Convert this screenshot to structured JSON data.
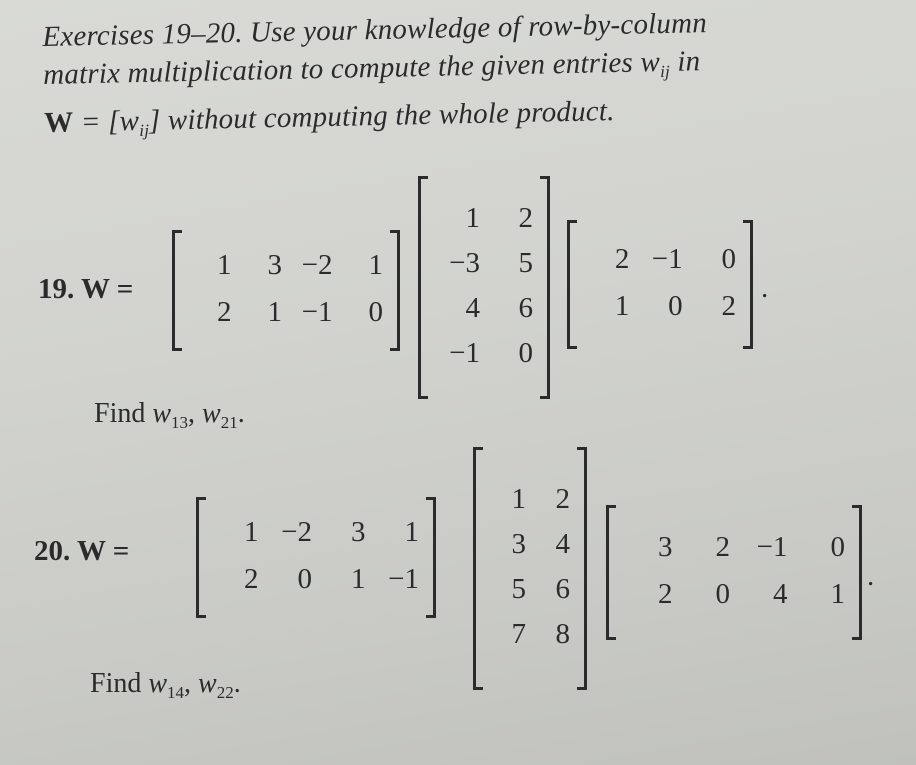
{
  "intro": {
    "line1": "Exercises 19–20.  Use  your  knowledge  of  row-by-column",
    "line2": "matrix  multiplication  to  compute  the  given  entries  w",
    "line2_sub": "ij",
    "line2_end": "  in",
    "line3_prefix": "W",
    "line3_eq": " = [w",
    "line3_sub": "ij",
    "line3_rest": "] without computing the whole product."
  },
  "exercises": [
    {
      "label": "19.  W =",
      "matrices": [
        [
          [
            "1",
            "3",
            "−2",
            "1"
          ],
          [
            "2",
            "1",
            "−1",
            "0"
          ]
        ],
        [
          [
            "1",
            "2"
          ],
          [
            "−3",
            "5"
          ],
          [
            "4",
            "6"
          ],
          [
            "−1",
            "0"
          ]
        ],
        [
          [
            "2",
            "−1",
            "0"
          ],
          [
            "1",
            "0",
            "2"
          ]
        ]
      ],
      "period": ".",
      "find_label": "Find",
      "find_entries": [
        {
          "var": "w",
          "sub": "13",
          "sep": ", "
        },
        {
          "var": "w",
          "sub": "21",
          "sep": "."
        }
      ]
    },
    {
      "label": "20.  W  =",
      "matrices": [
        [
          [
            "1",
            "−2",
            "3",
            "1"
          ],
          [
            "2",
            "0",
            "1",
            "−1"
          ]
        ],
        [
          [
            "1",
            "2"
          ],
          [
            "3",
            "4"
          ],
          [
            "5",
            "6"
          ],
          [
            "7",
            "8"
          ]
        ],
        [
          [
            "3",
            "2",
            "−1",
            "0"
          ],
          [
            "2",
            "0",
            "4",
            "1"
          ]
        ]
      ],
      "period": ".",
      "find_label": "Find",
      "find_entries": [
        {
          "var": "w",
          "sub": "14",
          "sep": ", "
        },
        {
          "var": "w",
          "sub": "22",
          "sep": "."
        }
      ]
    }
  ]
}
